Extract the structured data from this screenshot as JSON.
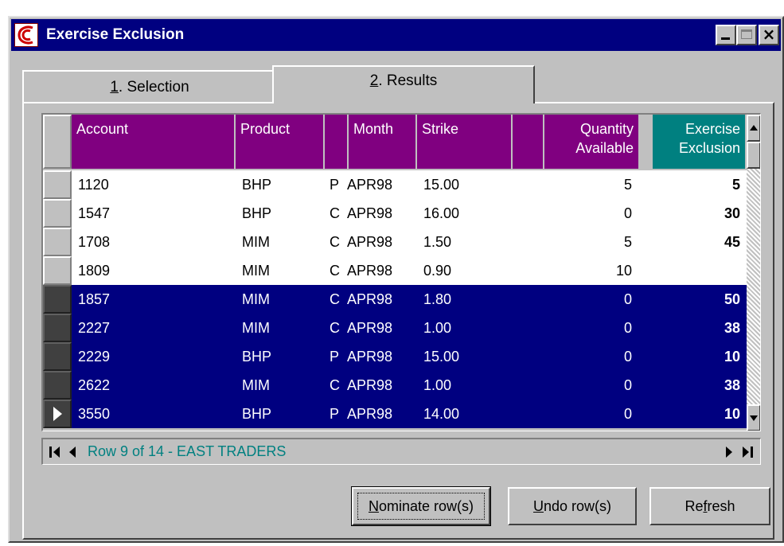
{
  "window": {
    "title": "Exercise Exclusion"
  },
  "tabs": [
    {
      "key": "1",
      "rest": ". Selection"
    },
    {
      "key": "2",
      "rest": ". Results"
    }
  ],
  "grid": {
    "headers": {
      "account": "Account",
      "product": "Product",
      "type": "",
      "month": "Month",
      "strike": "Strike",
      "blank": "",
      "qty_line1": "Quantity",
      "qty_line2": "Available",
      "excl_line1": "Exercise",
      "excl_line2": "Exclusion"
    },
    "rows": [
      {
        "account": "1120",
        "product": "BHP",
        "type": "P",
        "month": "APR98",
        "strike": "15.00",
        "qty": "5",
        "exclusion": "5",
        "selected": false
      },
      {
        "account": "1547",
        "product": "BHP",
        "type": "C",
        "month": "APR98",
        "strike": "16.00",
        "qty": "0",
        "exclusion": "30",
        "selected": false
      },
      {
        "account": "1708",
        "product": "MIM",
        "type": "C",
        "month": "APR98",
        "strike": "1.50",
        "qty": "5",
        "exclusion": "45",
        "selected": false
      },
      {
        "account": "1809",
        "product": "MIM",
        "type": "C",
        "month": "APR98",
        "strike": "0.90",
        "qty": "10",
        "exclusion": "",
        "selected": false
      },
      {
        "account": "1857",
        "product": "MIM",
        "type": "C",
        "month": "APR98",
        "strike": "1.80",
        "qty": "0",
        "exclusion": "50",
        "selected": true
      },
      {
        "account": "2227",
        "product": "MIM",
        "type": "C",
        "month": "APR98",
        "strike": "1.00",
        "qty": "0",
        "exclusion": "38",
        "selected": true
      },
      {
        "account": "2229",
        "product": "BHP",
        "type": "P",
        "month": "APR98",
        "strike": "15.00",
        "qty": "0",
        "exclusion": "10",
        "selected": true
      },
      {
        "account": "2622",
        "product": "MIM",
        "type": "C",
        "month": "APR98",
        "strike": "1.00",
        "qty": "0",
        "exclusion": "38",
        "selected": true
      },
      {
        "account": "3550",
        "product": "BHP",
        "type": "P",
        "month": "APR98",
        "strike": "14.00",
        "qty": "0",
        "exclusion": "10",
        "selected": true
      }
    ],
    "current_row": 9
  },
  "navigator": {
    "status": "Row 9 of 14 - EAST TRADERS"
  },
  "buttons": {
    "nominate_key": "N",
    "nominate_rest": "ominate row(s)",
    "undo_key": "U",
    "undo_rest": "ndo row(s)",
    "refresh_pre": "Re",
    "refresh_key": "f",
    "refresh_post": "resh"
  },
  "colors": {
    "titlebar": "#000080",
    "header": "#800080",
    "header_accent": "#008080",
    "selection": "#000080",
    "status_text": "#008080"
  }
}
